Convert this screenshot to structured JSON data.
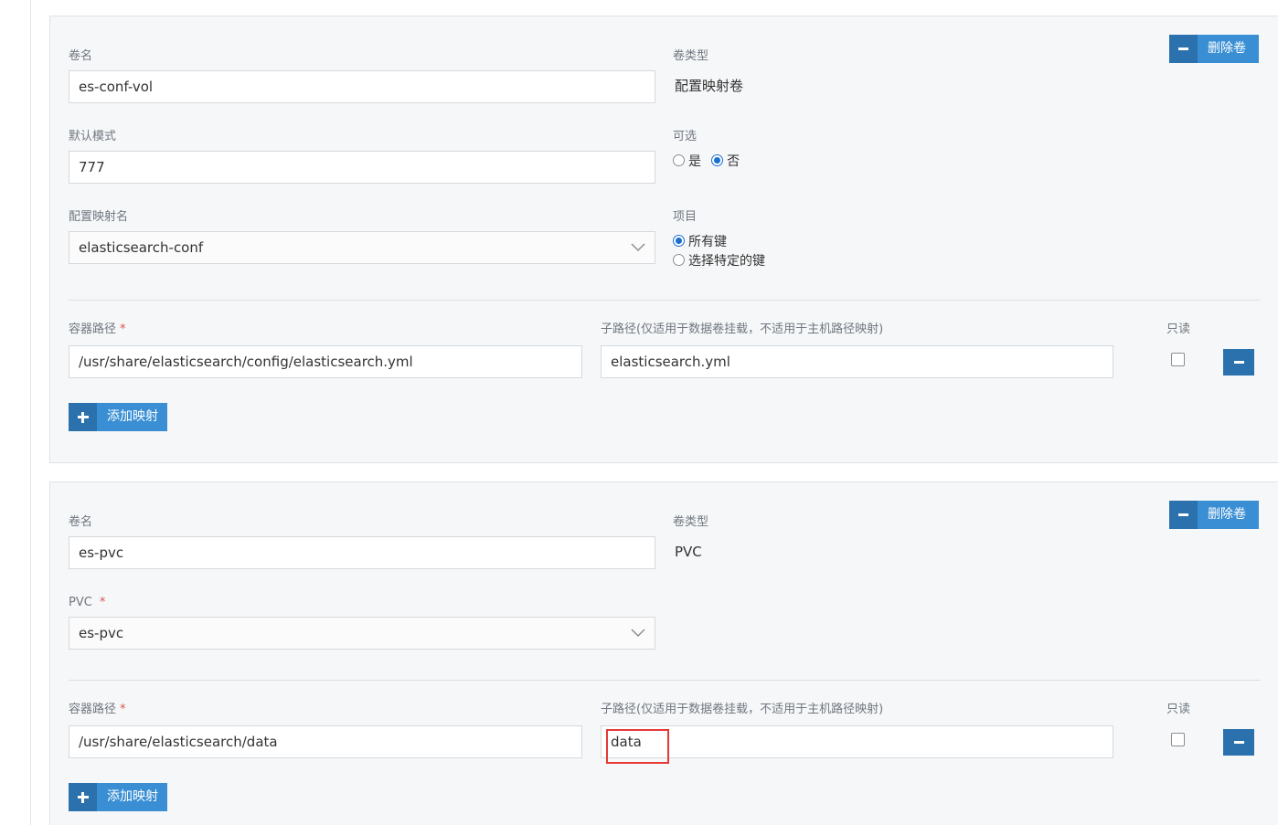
{
  "volumes": [
    {
      "delete_label": "删除卷",
      "name_label": "卷名",
      "name_value": "es-conf-vol",
      "type_label": "卷类型",
      "type_value": "配置映射卷",
      "mode_label": "默认模式",
      "mode_value": "777",
      "optional_label": "可选",
      "optional_yes": "是",
      "optional_no": "否",
      "optional_selected": "否",
      "configmap_label": "配置映射名",
      "configmap_value": "elasticsearch-conf",
      "items_label": "项目",
      "items_all_keys": "所有键",
      "items_specific_keys": "选择特定的键",
      "items_selected": "所有键",
      "mount": {
        "container_path_label": "容器路径",
        "container_path_required": "*",
        "container_path_value": "/usr/share/elasticsearch/config/elasticsearch.yml",
        "subpath_label": "子路径(仅适用于数据卷挂载，不适用于主机路径映射)",
        "subpath_value": "elasticsearch.yml",
        "readonly_label": "只读",
        "readonly_checked": false
      },
      "add_mapping_label": "添加映射"
    },
    {
      "delete_label": "删除卷",
      "name_label": "卷名",
      "name_value": "es-pvc",
      "type_label": "卷类型",
      "type_value": "PVC",
      "pvc_label": "PVC",
      "pvc_required": "*",
      "pvc_value": "es-pvc",
      "mount": {
        "container_path_label": "容器路径",
        "container_path_required": "*",
        "container_path_value": "/usr/share/elasticsearch/data",
        "subpath_label": "子路径(仅适用于数据卷挂载，不适用于主机路径映射)",
        "subpath_value": "data",
        "readonly_label": "只读",
        "readonly_checked": false
      },
      "add_mapping_label": "添加映射"
    }
  ],
  "colors": {
    "button_primary": "#3a8fd4",
    "button_icon": "#2a71ad",
    "highlight": "#e53935",
    "radio_selected": "#1b6fd1"
  }
}
